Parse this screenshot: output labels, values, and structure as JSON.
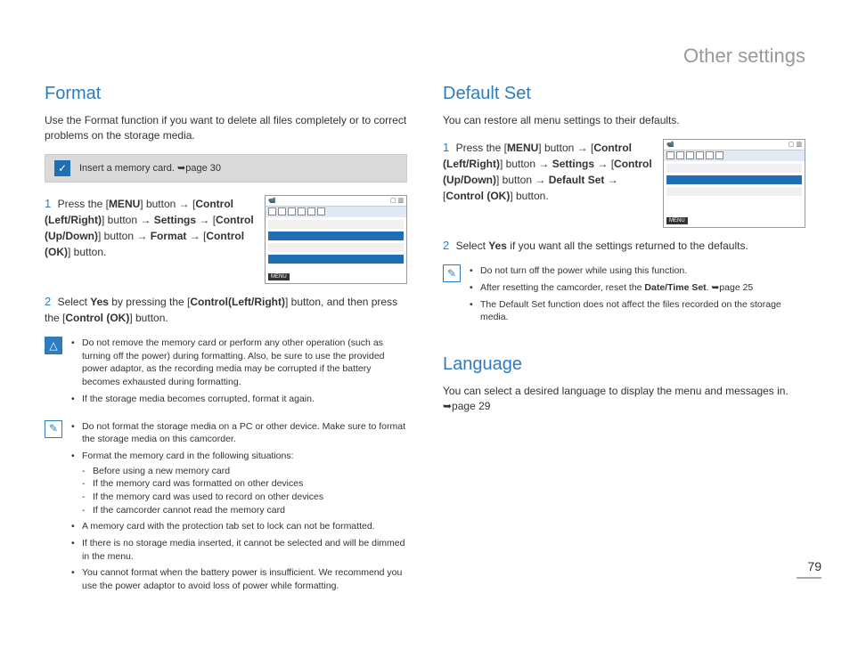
{
  "header": {
    "title": "Other settings"
  },
  "page_number": "79",
  "left": {
    "h": "Format",
    "intro": "Use the Format function if you want to delete all files completely or to correct problems on the storage media.",
    "memo": "Insert a memory card. ➥page 30",
    "step1_pre": "Press the [",
    "step1_menu": "MENU",
    "step1_a": "] button → [",
    "step1_ctrl_lr": "Control (Left/Right)",
    "step1_b": "] button → ",
    "step1_settings": "Settings",
    "step1_c": " → [",
    "step1_ctrl_ud": "Control (Up/Down)",
    "step1_d": "] button → ",
    "step1_format": "Format",
    "step1_e": " → [",
    "step1_ctrl_ok": "Control (OK)",
    "step1_f": "] button.",
    "step2_a": "Select ",
    "step2_yes": "Yes",
    "step2_b": " by pressing the [",
    "step2_ctrl": "Control(Left/Right)",
    "step2_c": "] button, and then press the [",
    "step2_ok": "Control (OK)",
    "step2_d": "] button.",
    "warn": [
      "Do not remove the memory card or perform any other operation (such as turning off the power) during formatting. Also, be sure to use the provided power adaptor, as the recording media may be corrupted if the battery becomes exhausted during formatting.",
      "If the storage media becomes corrupted, format it again."
    ],
    "info_item1": "Do not format the storage media on a PC or other device. Make sure to format the storage media on this camcorder.",
    "info_item2": "Format the memory card in the following situations:",
    "info_sub": [
      "Before using a new memory card",
      "If the memory card was formatted on other devices",
      "If the memory card was used to record on other devices",
      "If the camcorder cannot read the memory card"
    ],
    "info_rest": [
      "A memory card with the protection tab set to lock can not be formatted.",
      "If there is no storage media inserted, it cannot be selected and will be dimmed in the menu.",
      "You cannot format when the battery power is insufficient. We recommend you use the power adaptor to avoid loss of power while formatting."
    ],
    "menu_tag": "MENU"
  },
  "right": {
    "default_set": {
      "h": "Default Set",
      "intro": "You can restore all menu settings to their defaults.",
      "step1_pre": "Press the [",
      "step1_menu": "MENU",
      "step1_a": "] button → [",
      "step1_ctrl_lr": "Control (Left/Right)",
      "step1_b": "] button → ",
      "step1_settings": "Settings",
      "step1_c": " → [",
      "step1_ctrl_ud": "Control (Up/Down)",
      "step1_d": "] button → ",
      "step1_ds": "Default Set",
      "step1_e": " → [",
      "step1_ok": "Control (OK)",
      "step1_f": "] button.",
      "step2_a": "Select ",
      "step2_yes": "Yes",
      "step2_b": " if you want all the settings returned to the defaults.",
      "notes": [
        "Do not turn off the power while using this function.",
        "After resetting the camcorder, reset the Date/Time Set. ➥page 25",
        "The Default Set function does not affect the files recorded on the storage media."
      ],
      "note2_pre": "After resetting the camcorder, reset the ",
      "note2_bold": "Date/Time Set",
      "note2_post": ". ➥page 25",
      "menu_tag": "MENU"
    },
    "language": {
      "h": "Language",
      "intro": "You can select a desired language to display the menu and messages in. ➥page 29"
    }
  }
}
